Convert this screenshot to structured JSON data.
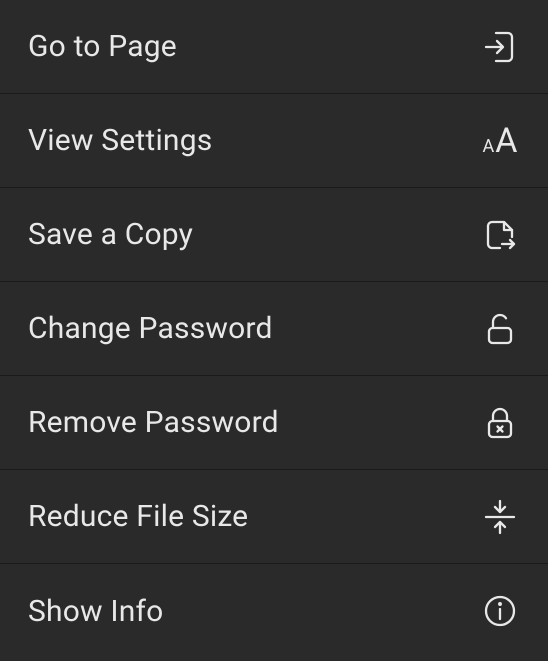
{
  "menu": {
    "items": [
      {
        "label": "Go to Page",
        "icon": "go-to-page-icon"
      },
      {
        "label": "View Settings",
        "icon": "text-size-icon"
      },
      {
        "label": "Save a Copy",
        "icon": "save-copy-icon"
      },
      {
        "label": "Change Password",
        "icon": "unlock-icon"
      },
      {
        "label": "Remove Password",
        "icon": "lock-remove-icon"
      },
      {
        "label": "Reduce File Size",
        "icon": "compress-icon"
      },
      {
        "label": "Show Info",
        "icon": "info-icon"
      }
    ]
  }
}
